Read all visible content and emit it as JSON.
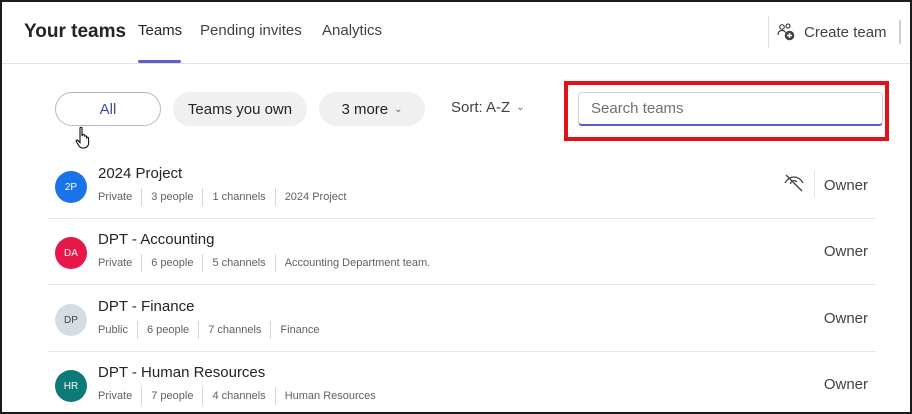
{
  "header": {
    "title": "Your teams",
    "tabs": [
      {
        "label": "Teams",
        "active": true
      },
      {
        "label": "Pending invites",
        "active": false
      },
      {
        "label": "Analytics",
        "active": false
      }
    ],
    "create_team_label": "Create team"
  },
  "filters": {
    "all_label": "All",
    "own_label": "Teams you own",
    "more_label": "3 more",
    "sort_label": "Sort: A-Z"
  },
  "search": {
    "placeholder": "Search teams",
    "value": ""
  },
  "colors": {
    "accent": "#5b5fc7",
    "highlight": "#e21017"
  },
  "teams": [
    {
      "initials": "2P",
      "avatar_color": "#1a73e8",
      "avatar_text_color": "#ffffff",
      "name": "2024 Project",
      "privacy": "Private",
      "people": "3 people",
      "channels": "1 channels",
      "description": "2024 Project",
      "role": "Owner",
      "hidden": true
    },
    {
      "initials": "DA",
      "avatar_color": "#e8174a",
      "avatar_text_color": "#ffffff",
      "name": "DPT - Accounting",
      "privacy": "Private",
      "people": "6 people",
      "channels": "5 channels",
      "description": "Accounting Department team.",
      "role": "Owner",
      "hidden": false
    },
    {
      "initials": "DP",
      "avatar_color": "#d5dce2",
      "avatar_text_color": "#3d4a55",
      "name": "DPT - Finance",
      "privacy": "Public",
      "people": "6 people",
      "channels": "7 channels",
      "description": "Finance",
      "role": "Owner",
      "hidden": false
    },
    {
      "initials": "HR",
      "avatar_color": "#0d7a78",
      "avatar_text_color": "#ffffff",
      "name": "DPT - Human Resources",
      "privacy": "Private",
      "people": "7 people",
      "channels": "4 channels",
      "description": "Human Resources",
      "role": "Owner",
      "hidden": false
    }
  ]
}
